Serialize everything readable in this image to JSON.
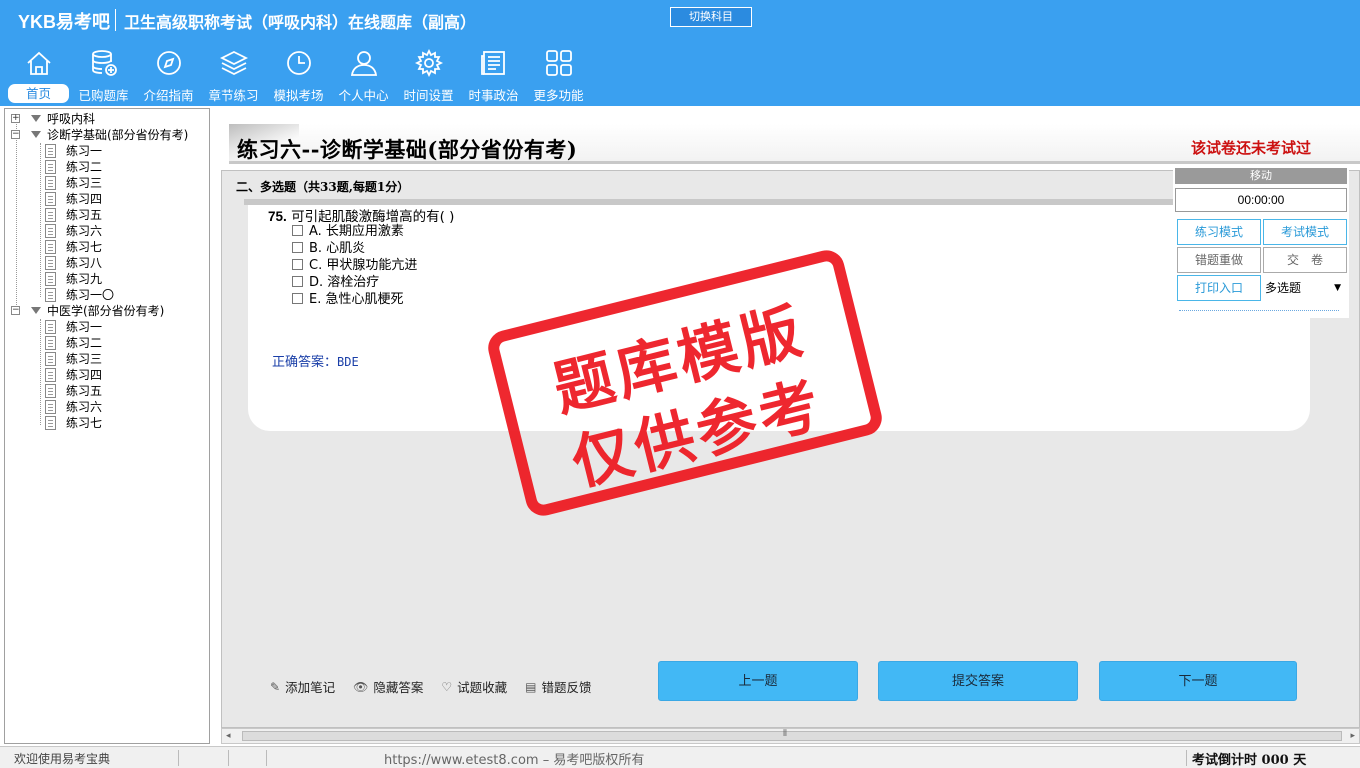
{
  "header": {
    "logo": "YKB易考吧",
    "title": "卫生高级职称考试（呼吸内科）在线题库（副高）",
    "switch_label": "切换科目",
    "nav": [
      {
        "label": "首页",
        "icon": "home-icon"
      },
      {
        "label": "已购题库",
        "icon": "database-icon"
      },
      {
        "label": "介绍指南",
        "icon": "compass-icon"
      },
      {
        "label": "章节练习",
        "icon": "layers-icon"
      },
      {
        "label": "模拟考场",
        "icon": "clock-icon"
      },
      {
        "label": "个人中心",
        "icon": "user-icon"
      },
      {
        "label": "时间设置",
        "icon": "gear-icon"
      },
      {
        "label": "时事政治",
        "icon": "newspaper-icon"
      },
      {
        "label": "更多功能",
        "icon": "grid-icon"
      }
    ]
  },
  "tree": {
    "root": "呼吸内科",
    "groups": [
      {
        "name": "诊断学基础(部分省份有考)",
        "items": [
          "练习一",
          "练习二",
          "练习三",
          "练习四",
          "练习五",
          "练习六",
          "练习七",
          "练习八",
          "练习九",
          "练习一〇"
        ]
      },
      {
        "name": "中医学(部分省份有考)",
        "items": [
          "练习一",
          "练习二",
          "练习三",
          "练习四",
          "练习五",
          "练习六",
          "练习七"
        ]
      }
    ]
  },
  "exam": {
    "title": "练习六--诊断学基础(部分省份有考)",
    "status": "该试卷还未考试过",
    "section": "二、多选题（共33题,每题1分）",
    "question": {
      "number": "75.",
      "text": "可引起肌酸激酶增高的有( )",
      "options": [
        "A. 长期应用激素",
        "B. 心肌炎",
        "C. 甲状腺功能亢进",
        "D. 溶栓治疗",
        "E. 急性心肌梗死"
      ],
      "answer_label": "正确答案：",
      "answer_value": "BDE"
    },
    "tools": [
      "添加笔记",
      "隐藏答案",
      "试题收藏",
      "错题反馈"
    ],
    "buttons": {
      "prev": "上一题",
      "submit": "提交答案",
      "next": "下一题"
    }
  },
  "control": {
    "move": "移动",
    "timer": "00:00:00",
    "practice_mode": "练习模式",
    "exam_mode": "考试模式",
    "redo_wrong": "错题重做",
    "hand_in": "交　卷",
    "print": "打印入口",
    "type_select": "多选题"
  },
  "stamp": {
    "line1": "题库模版",
    "line2": "仅供参考"
  },
  "status": {
    "welcome": "欢迎使用易考宝典",
    "url": "https://www.etest8.com – 易考吧版权所有",
    "countdown": "考试倒计时 000 天"
  },
  "colors": {
    "header": "#3aa0f0",
    "button": "#42b8f5",
    "stamp": "#ee1c24",
    "status_red": "#cc1111"
  }
}
